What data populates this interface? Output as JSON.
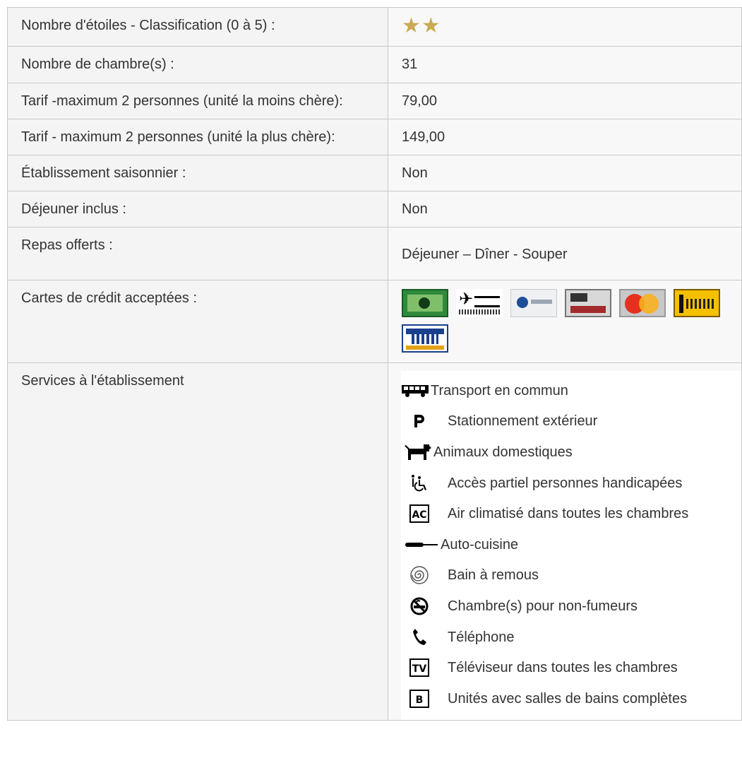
{
  "rows": {
    "stars": {
      "label": "Nombre d'étoiles - Classification (0 à 5) :",
      "value": "★★",
      "rating": 2,
      "max": 5,
      "star_color": "#cbaa55"
    },
    "rooms": {
      "label": "Nombre de chambre(s) :",
      "value": "31"
    },
    "rate_min": {
      "label": "Tarif -maximum 2 personnes (unité la moins chère):",
      "value": "79,00"
    },
    "rate_max": {
      "label": "Tarif - maximum 2 personnes (unité la plus chère):",
      "value": "149,00"
    },
    "seasonal": {
      "label": "Établissement saisonnier :",
      "value": "Non"
    },
    "breakfast": {
      "label": "Déjeuner inclus :",
      "value": "Non"
    },
    "meals": {
      "label": "Repas offerts :",
      "value": "Déjeuner – Dîner - Souper"
    },
    "cards": {
      "label": "Cartes de crédit acceptées :"
    },
    "services": {
      "label": "Services à l'établissement"
    }
  },
  "credit_cards": [
    {
      "icon": "amex-card-icon"
    },
    {
      "icon": "enroute-card-icon"
    },
    {
      "icon": "diners-club-card-icon"
    },
    {
      "icon": "carte-blanche-card-icon"
    },
    {
      "icon": "mastercard-card-icon"
    },
    {
      "icon": "interac-card-icon"
    },
    {
      "icon": "visa-card-icon"
    }
  ],
  "services": [
    {
      "icon": "bus-icon",
      "label": "Transport en commun"
    },
    {
      "icon": "parking-icon",
      "label": "Stationnement extérieur"
    },
    {
      "icon": "dog-icon",
      "label": "Animaux domestiques"
    },
    {
      "icon": "wheelchair-icon",
      "label": "Accès partiel personnes handicapées"
    },
    {
      "icon": "air-conditioning-icon",
      "label": "Air climatisé dans toutes les chambres"
    },
    {
      "icon": "pan-icon",
      "label": "Auto-cuisine"
    },
    {
      "icon": "whirlpool-icon",
      "label": "Bain à remous"
    },
    {
      "icon": "no-smoking-icon",
      "label": "Chambre(s) pour non-fumeurs"
    },
    {
      "icon": "phone-icon",
      "label": "Téléphone"
    },
    {
      "icon": "tv-icon",
      "label": "Téléviseur dans toutes les chambres"
    },
    {
      "icon": "bath-icon",
      "label": "Unités avec salles de bains complètes"
    }
  ]
}
